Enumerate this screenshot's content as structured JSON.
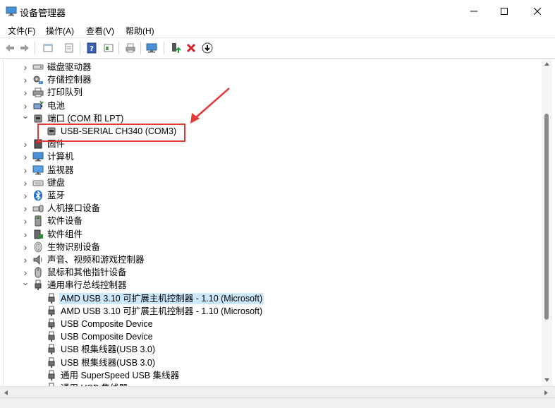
{
  "window": {
    "title": "设备管理器",
    "accent": "#0067c0",
    "controls": [
      "minimize-icon",
      "maximize-icon",
      "close-icon"
    ]
  },
  "menu": [
    "文件(F)",
    "操作(A)",
    "查看(V)",
    "帮助(H)"
  ],
  "toolbar": [
    "back-icon",
    "forward-icon",
    "properties-icon",
    "update-driver-icon",
    "help-icon",
    "view-icon",
    "print-icon",
    "scan-hardware-icon",
    "enable-device-icon",
    "uninstall-icon",
    "download-icon"
  ],
  "tree": {
    "items": [
      {
        "label": "磁盘驱动器",
        "icon": "disk-drive-icon",
        "level": 1,
        "state": "collapsed"
      },
      {
        "label": "存储控制器",
        "icon": "storage-controller-icon",
        "level": 1,
        "state": "collapsed"
      },
      {
        "label": "打印队列",
        "icon": "printer-icon",
        "level": 1,
        "state": "collapsed"
      },
      {
        "label": "电池",
        "icon": "battery-icon",
        "level": 1,
        "state": "collapsed"
      },
      {
        "label": "端口 (COM 和 LPT)",
        "icon": "port-icon",
        "level": 1,
        "state": "expanded"
      },
      {
        "label": "USB-SERIAL CH340 (COM3)",
        "icon": "port-icon",
        "level": 2,
        "state": "leaf"
      },
      {
        "label": "固件",
        "icon": "firmware-icon",
        "level": 1,
        "state": "collapsed"
      },
      {
        "label": "计算机",
        "icon": "computer-icon",
        "level": 1,
        "state": "collapsed"
      },
      {
        "label": "监视器",
        "icon": "monitor-icon",
        "level": 1,
        "state": "collapsed"
      },
      {
        "label": "键盘",
        "icon": "keyboard-icon",
        "level": 1,
        "state": "collapsed"
      },
      {
        "label": "蓝牙",
        "icon": "bluetooth-icon",
        "level": 1,
        "state": "collapsed"
      },
      {
        "label": "人机接口设备",
        "icon": "hid-icon",
        "level": 1,
        "state": "collapsed"
      },
      {
        "label": "软件设备",
        "icon": "software-device-icon",
        "level": 1,
        "state": "collapsed"
      },
      {
        "label": "软件组件",
        "icon": "software-component-icon",
        "level": 1,
        "state": "collapsed"
      },
      {
        "label": "生物识别设备",
        "icon": "biometric-icon",
        "level": 1,
        "state": "collapsed"
      },
      {
        "label": "声音、视频和游戏控制器",
        "icon": "speaker-icon",
        "level": 1,
        "state": "collapsed"
      },
      {
        "label": "鼠标和其他指针设备",
        "icon": "mouse-icon",
        "level": 1,
        "state": "collapsed"
      },
      {
        "label": "通用串行总线控制器",
        "icon": "usb-icon",
        "level": 1,
        "state": "expanded"
      },
      {
        "label": "AMD USB 3.10 可扩展主机控制器 - 1.10 (Microsoft)",
        "icon": "usb-icon",
        "level": 2,
        "state": "leaf",
        "selected": true
      },
      {
        "label": "AMD USB 3.10 可扩展主机控制器 - 1.10 (Microsoft)",
        "icon": "usb-icon",
        "level": 2,
        "state": "leaf"
      },
      {
        "label": "USB Composite Device",
        "icon": "usb-icon",
        "level": 2,
        "state": "leaf"
      },
      {
        "label": "USB Composite Device",
        "icon": "usb-icon",
        "level": 2,
        "state": "leaf"
      },
      {
        "label": "USB 根集线器(USB 3.0)",
        "icon": "usb-icon",
        "level": 2,
        "state": "leaf"
      },
      {
        "label": "USB 根集线器(USB 3.0)",
        "icon": "usb-icon",
        "level": 2,
        "state": "leaf"
      },
      {
        "label": "通用 SuperSpeed USB 集线器",
        "icon": "usb-icon",
        "level": 2,
        "state": "leaf"
      },
      {
        "label": "通用 USB 集线器",
        "icon": "usb-icon",
        "level": 2,
        "state": "leaf"
      }
    ]
  },
  "annotation": {
    "color": "#e53935"
  }
}
